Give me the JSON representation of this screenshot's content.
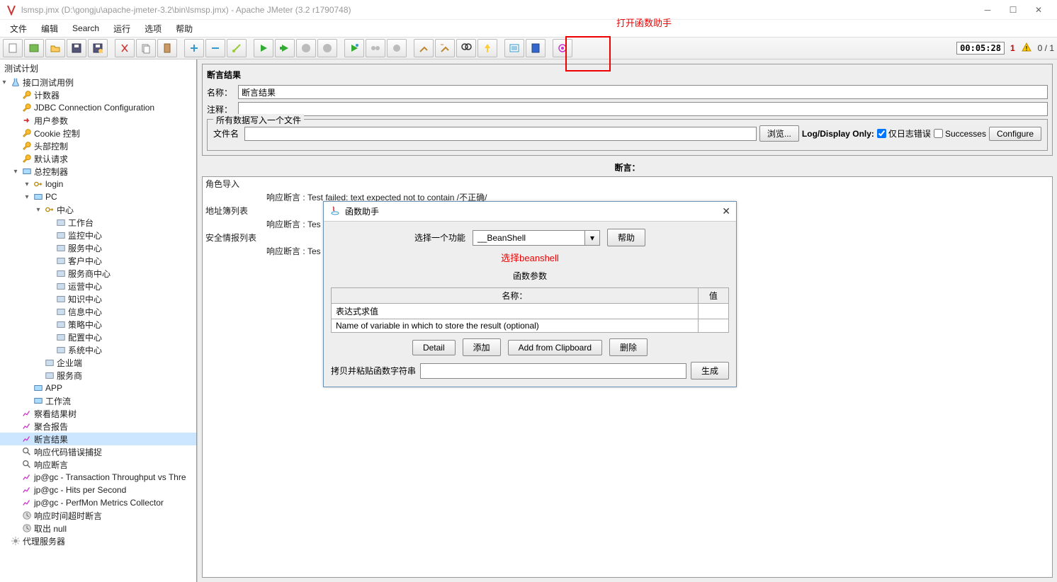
{
  "title": "lsmsp.jmx (D:\\gongju\\apache-jmeter-3.2\\bin\\lsmsp.jmx) - Apache JMeter (3.2 r1790748)",
  "menu": [
    "文件",
    "编辑",
    "Search",
    "运行",
    "选项",
    "帮助"
  ],
  "toolbar": {
    "time": "00:05:28",
    "warn_count": "1",
    "run_count": "0 / 1"
  },
  "anno": {
    "open": "打开函数助手",
    "select": "选择beanshell"
  },
  "tree": {
    "header": "测试计划",
    "root": "接口测试用例",
    "items": [
      {
        "l": 1,
        "t": "计数器",
        "ic": "wrench"
      },
      {
        "l": 1,
        "t": "JDBC Connection Configuration",
        "ic": "wrench"
      },
      {
        "l": 1,
        "t": "用户参数",
        "ic": "arrow"
      },
      {
        "l": 1,
        "t": "Cookie 控制",
        "ic": "wrench"
      },
      {
        "l": 1,
        "t": "头部控制",
        "ic": "wrench"
      },
      {
        "l": 1,
        "t": "默认请求",
        "ic": "wrench"
      },
      {
        "l": 1,
        "t": "总控制器",
        "ic": "ctrl",
        "exp": true
      },
      {
        "l": 2,
        "t": "login",
        "ic": "key",
        "exp": true
      },
      {
        "l": 2,
        "t": "PC",
        "ic": "ctrl",
        "exp": true
      },
      {
        "l": 3,
        "t": "中心",
        "ic": "key",
        "exp": true
      },
      {
        "l": 4,
        "t": "工作台",
        "ic": "folder"
      },
      {
        "l": 4,
        "t": "监控中心",
        "ic": "folder"
      },
      {
        "l": 4,
        "t": "服务中心",
        "ic": "folder"
      },
      {
        "l": 4,
        "t": "客户中心",
        "ic": "folder"
      },
      {
        "l": 4,
        "t": "服务商中心",
        "ic": "folder"
      },
      {
        "l": 4,
        "t": "运营中心",
        "ic": "folder"
      },
      {
        "l": 4,
        "t": "知识中心",
        "ic": "folder"
      },
      {
        "l": 4,
        "t": "信息中心",
        "ic": "folder"
      },
      {
        "l": 4,
        "t": "策略中心",
        "ic": "folder"
      },
      {
        "l": 4,
        "t": "配置中心",
        "ic": "folder"
      },
      {
        "l": 4,
        "t": "系统中心",
        "ic": "folder"
      },
      {
        "l": 3,
        "t": "企业端",
        "ic": "folder"
      },
      {
        "l": 3,
        "t": "服务商",
        "ic": "folder"
      },
      {
        "l": 2,
        "t": "APP",
        "ic": "ctrl"
      },
      {
        "l": 2,
        "t": "工作流",
        "ic": "ctrl"
      },
      {
        "l": 1,
        "t": "察看结果树",
        "ic": "graph"
      },
      {
        "l": 1,
        "t": "聚合报告",
        "ic": "graph"
      },
      {
        "l": 1,
        "t": "断言结果",
        "ic": "graph",
        "sel": true
      },
      {
        "l": 1,
        "t": "响应代码错误捕捉",
        "ic": "mag"
      },
      {
        "l": 1,
        "t": "响应断言",
        "ic": "mag"
      },
      {
        "l": 1,
        "t": "jp@gc - Transaction Throughput vs Thre",
        "ic": "graph"
      },
      {
        "l": 1,
        "t": "jp@gc - Hits per Second",
        "ic": "graph"
      },
      {
        "l": 1,
        "t": "jp@gc - PerfMon Metrics Collector",
        "ic": "graph"
      },
      {
        "l": 1,
        "t": "响应时间超时断言",
        "ic": "clock"
      },
      {
        "l": 1,
        "t": "取出 null",
        "ic": "clock"
      }
    ],
    "footer": "代理服务器"
  },
  "panel": {
    "title": "断言结果",
    "name_label": "名称：",
    "name_value": "断言结果",
    "comment_label": "注释：",
    "fieldset_legend": "所有数据写入一个文件",
    "file_label": "文件名",
    "browse": "浏览...",
    "logonly": "Log/Display Only:",
    "errors": "仅日志错误",
    "successes": "Successes",
    "configure": "Configure",
    "assert_header": "断言：",
    "lines": [
      "角色导入",
      "响应断言 : Test failed: text expected not to contain /不正确/",
      "地址簿列表",
      "响应断言 : Tes",
      "安全情报列表",
      "响应断言 : Tes"
    ]
  },
  "dialog": {
    "title": "函数助手",
    "select_label": "选择一个功能",
    "select_value": "__BeanShell",
    "help": "帮助",
    "params_header": "函数参数",
    "th_name": "名称：",
    "th_value": "值",
    "rows": [
      "表达式求值",
      "Name of variable in which to store the result (optional)"
    ],
    "btn_detail": "Detail",
    "btn_add": "添加",
    "btn_clip": "Add from Clipboard",
    "btn_del": "删除",
    "gen_label": "拷贝并粘贴函数字符串",
    "btn_gen": "生成"
  }
}
